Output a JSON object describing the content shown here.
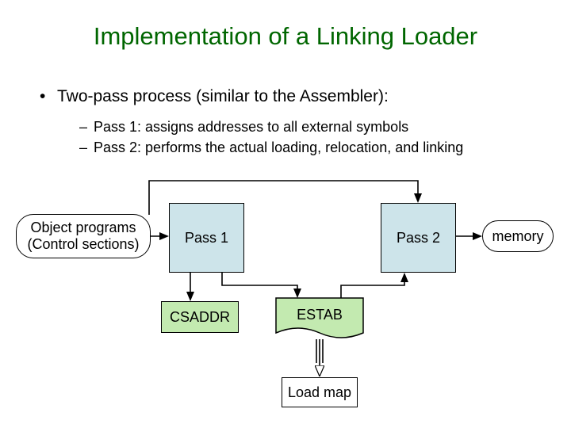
{
  "title": "Implementation of a Linking Loader",
  "bullet": "Two-pass process (similar to the Assembler):",
  "sub1": "Pass 1: assigns addresses to all external symbols",
  "sub2": "Pass 2: performs the actual loading, relocation, and linking",
  "nodes": {
    "objprog_line1": "Object programs",
    "objprog_line2": "(Control sections)",
    "pass1": "Pass 1",
    "pass2": "Pass 2",
    "memory": "memory",
    "csaddr": "CSADDR",
    "estab": "ESTAB",
    "loadmap": "Load map"
  }
}
